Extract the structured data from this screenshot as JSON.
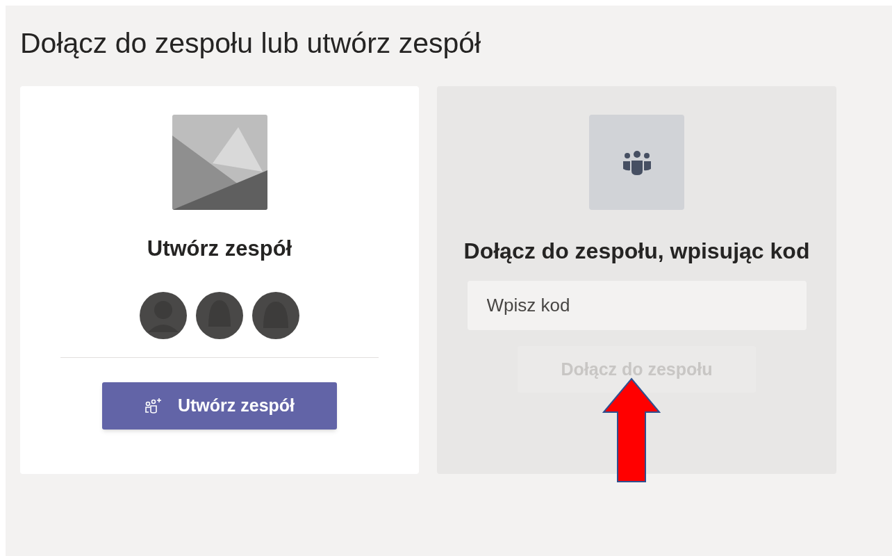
{
  "page_title": "Dołącz do zespołu lub utwórz zespół",
  "create_card": {
    "heading": "Utwórz zespół",
    "button": {
      "label": "Utwórz zespół",
      "disabled": false
    }
  },
  "join_card": {
    "heading": "Dołącz do zespołu, wpisując kod",
    "code_field": {
      "placeholder": "Wpisz kod"
    },
    "button": {
      "label": "Dołącz do zespołu",
      "disabled": true
    }
  }
}
